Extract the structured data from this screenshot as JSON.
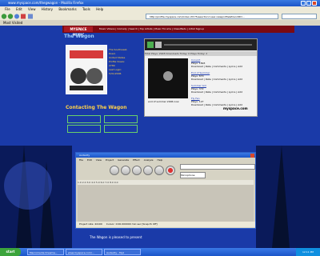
{
  "browser": {
    "title": "www.myspace.com/thegwagon - Mozilla Firefox",
    "menu": [
      "File",
      "Edit",
      "View",
      "History",
      "Bookmarks",
      "Tools",
      "Help"
    ],
    "url": "http://profile.myspace.com/index.cfm?fuseaction=user.viewprofile&friendID=...",
    "tabs_label": "Most Visited"
  },
  "myspace": {
    "logo": "MYSPACE MUSIC",
    "nav": "Music Videos | Comedy | Search | Top Artists | Music Forums | Classifieds | Artist Signup",
    "band_name": "The Wagon",
    "band_info": [
      "The Southwest,",
      "Road,",
      "United States",
      "",
      "Profile Views:",
      "2780",
      "",
      "Last Login:",
      "5/31/2006"
    ],
    "connect_title": "Contacting The Wagon",
    "player": {
      "label": "Total Plays: 2928   Downloads Today: 0   Plays Today: 2",
      "songs": [
        {
          "title": "Convict",
          "meta": "Plays: 1893",
          "links": "Download | Rate | Comments | Lyrics | Add"
        },
        {
          "title": "End of Summer",
          "meta": "Plays: 870",
          "links": "Download | Rate | Comments | Lyrics | Add"
        },
        {
          "title": "Summer Girl",
          "meta": "Plays: 372",
          "links": "Download | Rate | Comments | Lyrics | Add"
        },
        {
          "title": "Fly Fan",
          "meta": "Plays: 127",
          "links": "Download | Rate | Comments | Lyrics | Add"
        }
      ],
      "album_caption": "end of summer 2006 now",
      "brand": "myspace.com"
    },
    "footer_text": "The Wagon is pleased to present"
  },
  "audacity": {
    "title": "Audacity",
    "menu": [
      "File",
      "Edit",
      "View",
      "Project",
      "Generate",
      "Effect",
      "Analyze",
      "Help"
    ],
    "device": "Microphone",
    "timeline": "1.0     2.0     3.0     4.0     5.0     6.0     7.0     8.0     9.0",
    "status_rate": "Project rate: 44100",
    "status_cursor": "Cursor: 0:00.000000 min:sec  [Snap-To Off]",
    "status_left": "Stopped"
  },
  "taskbar": {
    "start": "start",
    "tasks": [
      "Macromedia Dreamw...",
      "www.myspace.com/...",
      "Audacity - Myz"
    ],
    "time": "12:11 PM"
  }
}
